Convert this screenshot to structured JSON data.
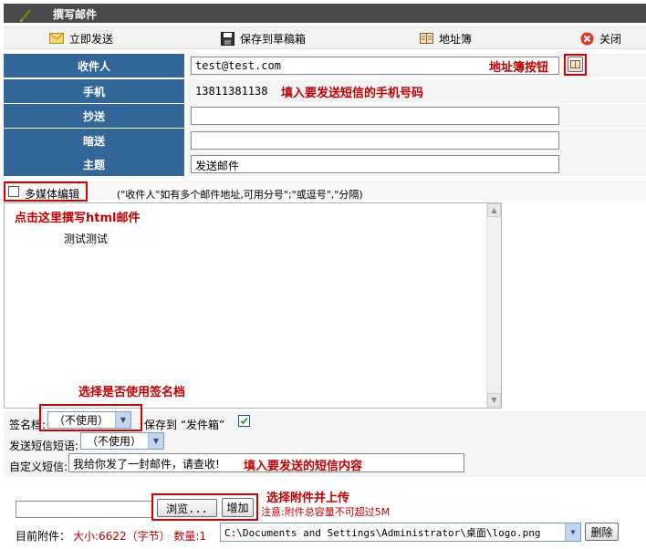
{
  "header": {
    "title": "撰写邮件"
  },
  "toolbar": {
    "send_label": "立即发送",
    "draft_label": "保存到草稿箱",
    "addressbook_label": "地址簿",
    "close_label": "关闭"
  },
  "form": {
    "to_label": "收件人",
    "to_value": "test@test.com",
    "to_annotation": "地址簿按钮",
    "mobile_label": "手机",
    "mobile_value": "13811381138",
    "mobile_annotation": "填入要发送短信的手机号码",
    "cc_label": "抄送",
    "cc_value": "",
    "bcc_label": "暗送",
    "bcc_value": "",
    "subject_label": "主题",
    "subject_value": "发送邮件"
  },
  "editor": {
    "multimedia_label": "多媒体编辑",
    "hint": "(\"收件人\"如有多个邮件地址,可用分号\";\"或逗号\",\"分隔)",
    "html_annotation": "点击这里撰写html邮件",
    "body_text": "测试测试",
    "signature_annotation": "选择是否使用签名档"
  },
  "options": {
    "signature_label": "签名档:",
    "signature_value": "（不使用）",
    "save_sent_label": "保存到 “发件箱”",
    "sms_phrase_label": "发送短信短语:",
    "sms_phrase_value": "（不使用）",
    "custom_sms_label": "自定义短信:",
    "custom_sms_value": "我给你发了一封邮件，请查收!",
    "custom_sms_annotation": "填入要发送的短信内容"
  },
  "attachment": {
    "upload_annotation": "选择附件并上传",
    "browse_label": "浏览...",
    "add_label": "增加",
    "size_note": "注意:附件总容量不可超过5M",
    "current_label": "目前附件：",
    "size_info": "大小:6622（字节） 数量:1",
    "file_value": "C:\\Documents and Settings\\Administrator\\桌面\\logo.png",
    "delete_label": "删除"
  }
}
